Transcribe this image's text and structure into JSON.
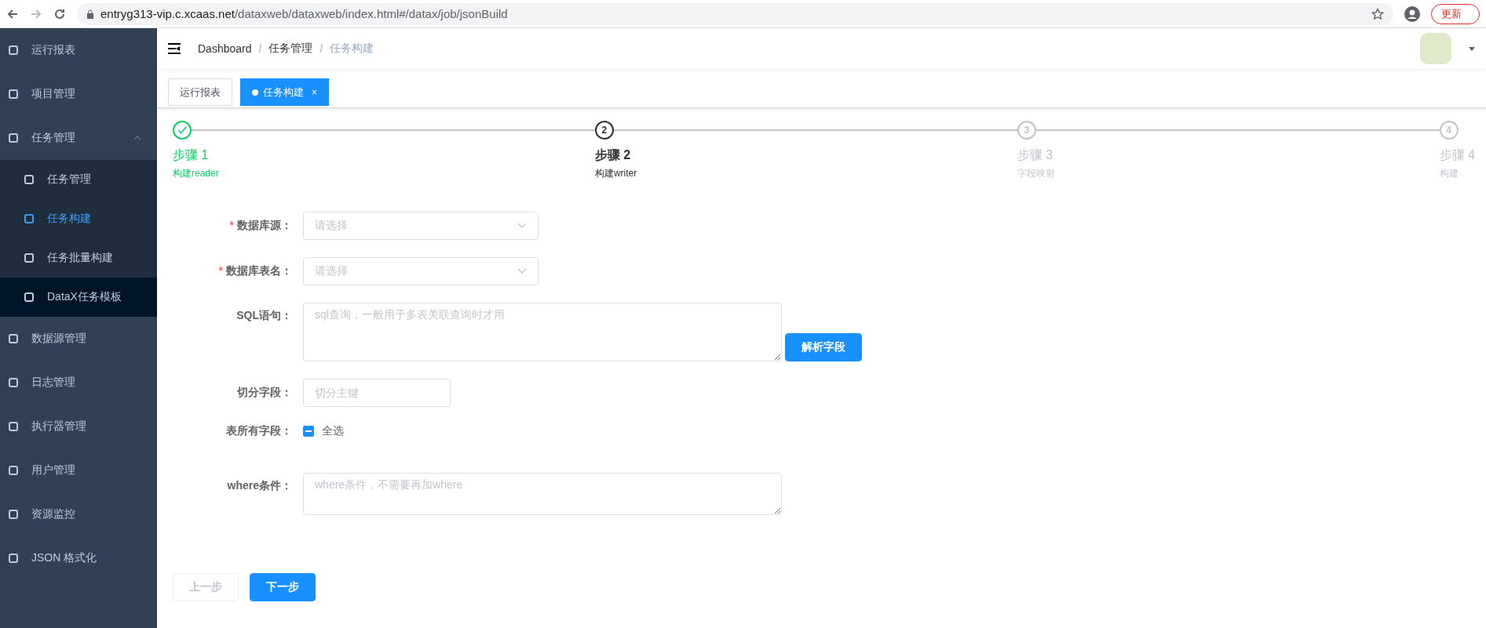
{
  "browser": {
    "url_host": "entryg313-vip.c.xcaas.net",
    "url_path": "/dataxweb/dataxweb/index.html#/datax/job/jsonBuild",
    "update_button": "更新"
  },
  "sidebar": {
    "items": [
      {
        "label": "运行报表",
        "selected": false
      },
      {
        "label": "项目管理",
        "selected": false
      },
      {
        "label": "任务管理",
        "selected": false,
        "expanded": true,
        "children": [
          {
            "label": "任务管理",
            "selected": false,
            "hovered": false
          },
          {
            "label": "任务构建",
            "selected": true,
            "hovered": false
          },
          {
            "label": "任务批量构建",
            "selected": false,
            "hovered": false
          },
          {
            "label": "DataX任务模板",
            "selected": false,
            "hovered": true
          }
        ]
      },
      {
        "label": "数据源管理",
        "selected": false
      },
      {
        "label": "日志管理",
        "selected": false
      },
      {
        "label": "执行器管理",
        "selected": false
      },
      {
        "label": "用户管理",
        "selected": false
      },
      {
        "label": "资源监控",
        "selected": false
      },
      {
        "label": "JSON 格式化",
        "selected": false
      }
    ]
  },
  "breadcrumb": [
    {
      "kind": "link",
      "text": "Dashboard"
    },
    {
      "kind": "separator",
      "text": "/"
    },
    {
      "kind": "link",
      "text": "任务管理"
    },
    {
      "kind": "separator",
      "text": "/"
    },
    {
      "kind": "current",
      "text": "任务构建"
    }
  ],
  "tabs": [
    {
      "label": "运行报表",
      "selected": false
    },
    {
      "label": "任务构建",
      "selected": true,
      "close": "×"
    }
  ],
  "steps": [
    {
      "title": "步骤 1",
      "description": "构建reader",
      "kind": "finish"
    },
    {
      "number": "2",
      "title": "步骤 2",
      "description": "构建writer",
      "kind": "process"
    },
    {
      "number": "3",
      "title": "步骤 3",
      "description": "字段映射",
      "kind": "wait"
    },
    {
      "number": "4",
      "title": "步骤 4",
      "description": "构建",
      "kind": "wait"
    }
  ],
  "form": [
    {
      "kind": "select",
      "label": "数据库源：",
      "required_mark": "*",
      "placeholder": "请选择"
    },
    {
      "kind": "select",
      "label": "数据库表名：",
      "required_mark": "*",
      "placeholder": "请选择"
    },
    {
      "kind": "sql",
      "label": "SQL语句：",
      "placeholder": "sql查询，一般用于多表关联查询时才用",
      "button": "解析字段"
    },
    {
      "kind": "input",
      "label": "切分字段：",
      "placeholder": "切分主键"
    },
    {
      "kind": "checkbox",
      "label": "表所有字段：",
      "option": "全选",
      "indeterminate": true
    },
    {
      "kind": "textarea",
      "label": "where条件：",
      "placeholder": "where条件，不需要再加where"
    }
  ],
  "buttons": [
    {
      "label": "上一步",
      "disabled": true
    },
    {
      "label": "下一步",
      "disabled": false
    }
  ]
}
